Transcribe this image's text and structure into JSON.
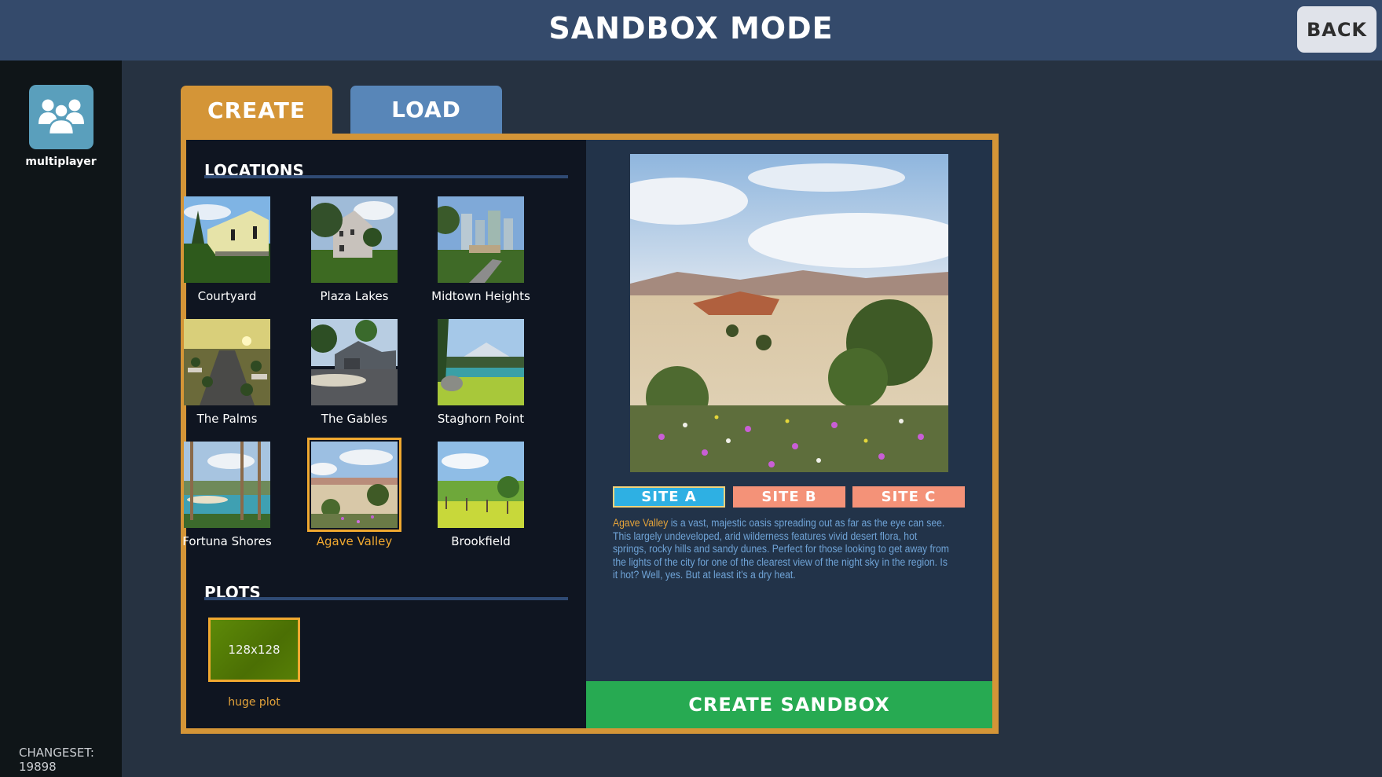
{
  "header": {
    "title": "SANDBOX MODE",
    "back_label": "BACK"
  },
  "sidebar": {
    "multiplayer_icon": "multiplayer-icon",
    "multiplayer_label": "multiplayer",
    "changeset": "CHANGESET: 19898"
  },
  "tabs": [
    {
      "label": "CREATE",
      "active": true
    },
    {
      "label": "LOAD",
      "active": false
    }
  ],
  "locations": {
    "title": "LOCATIONS",
    "items": [
      {
        "label": "Courtyard",
        "selected": false
      },
      {
        "label": "Plaza Lakes",
        "selected": false
      },
      {
        "label": "Midtown Heights",
        "selected": false
      },
      {
        "label": "The Palms",
        "selected": false
      },
      {
        "label": "The Gables",
        "selected": false
      },
      {
        "label": "Staghorn Point",
        "selected": false
      },
      {
        "label": "Fortuna Shores",
        "selected": false
      },
      {
        "label": "Agave Valley",
        "selected": true
      },
      {
        "label": "Brookfield",
        "selected": false
      }
    ]
  },
  "plots": {
    "title": "PLOTS",
    "items": [
      {
        "size": "128x128",
        "label": "huge plot",
        "selected": true
      }
    ]
  },
  "detail": {
    "preview_name": "Agave Valley",
    "sites": [
      {
        "label": "SITE A",
        "selected": true
      },
      {
        "label": "SITE B",
        "selected": false
      },
      {
        "label": "SITE C",
        "selected": false
      }
    ],
    "description_highlight": "Agave Valley",
    "description_body": " is a vast, majestic oasis spreading out as far as the eye can see. This largely undeveloped, arid wilderness features vivid desert flora, hot springs, rocky hills and sandy dunes. Perfect for those looking to get away from the lights of the city for one of the clearest view of the night sky in the region. Is it hot? Well, yes. But at least it's a dry heat.",
    "create_label": "CREATE SANDBOX"
  },
  "colors": {
    "header_bg": "#344a6b",
    "accent_orange": "#d49537",
    "selected_orange": "#f0a830",
    "load_tab_blue": "#5886b8",
    "site_selected": "#2eb0e3",
    "site_unselected": "#f49278",
    "create_green": "#27aa52",
    "description_text": "#6fa3d6"
  }
}
